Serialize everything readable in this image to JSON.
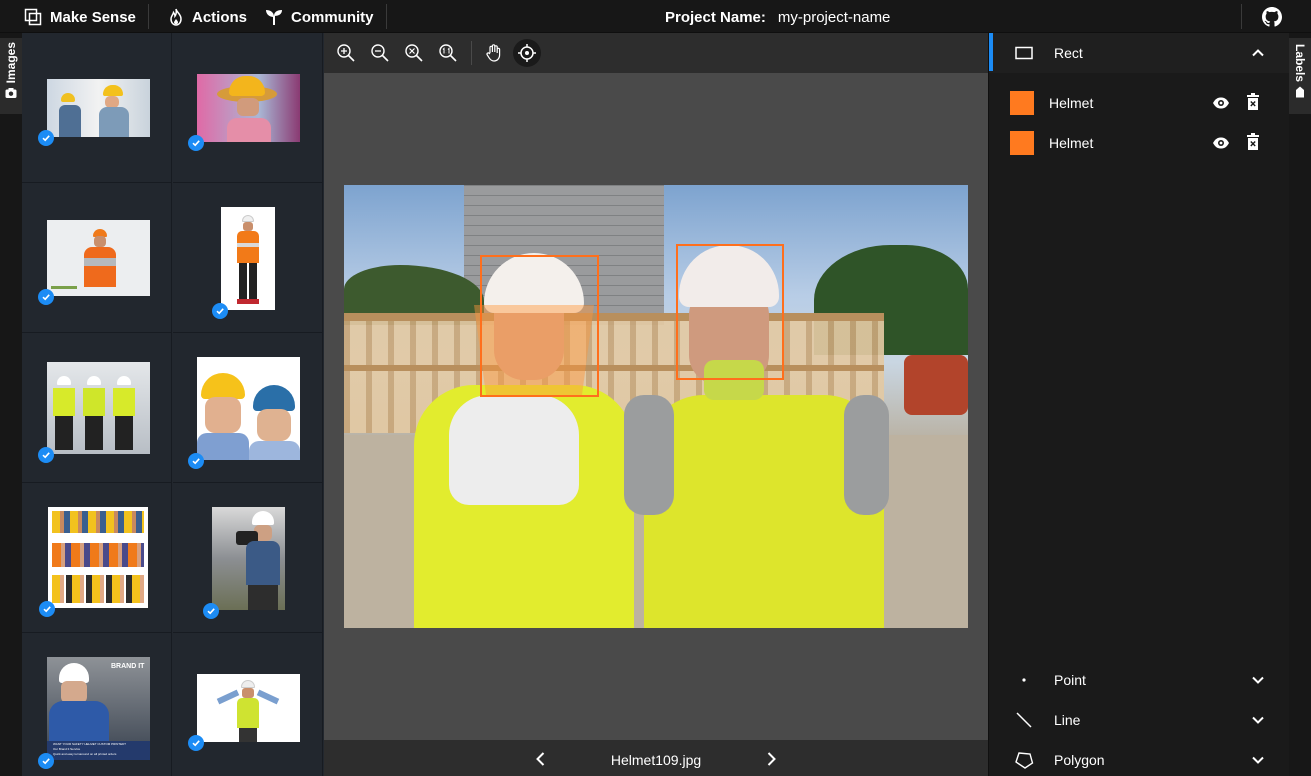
{
  "app": {
    "title": "Make Sense"
  },
  "menu": {
    "actions": "Actions",
    "community": "Community"
  },
  "project": {
    "label": "Project Name:",
    "name": "my-project-name"
  },
  "left_tab": {
    "label": "Images"
  },
  "right_tab": {
    "label": "Labels"
  },
  "gallery": {
    "images": [
      {
        "alt": "two workers in hard hats",
        "checked": true
      },
      {
        "alt": "worker with straw hat",
        "checked": true
      },
      {
        "alt": "worker arms crossed",
        "checked": true
      },
      {
        "alt": "standing worker orange vest",
        "checked": true
      },
      {
        "alt": "group of workers",
        "checked": true
      },
      {
        "alt": "two engineers helmets",
        "checked": true
      },
      {
        "alt": "crowd of workers",
        "checked": true
      },
      {
        "alt": "surveyor with camera",
        "checked": true
      },
      {
        "alt": "worker brand it poster",
        "checked": true,
        "poster_title": "BRAND IT",
        "poster_line1": "WANT YOUR SAFETY HELMET CUSTOM PRINTED?",
        "poster_line2": "Our Brand It Service",
        "poster_line3": "Quick and easy turnaround on all printed orders"
      },
      {
        "alt": "worker shrugging",
        "checked": true
      }
    ]
  },
  "editor": {
    "filename": "Helmet109.jpg",
    "annotations": [
      {
        "label": "Helmet",
        "color": "#ff6f1c"
      },
      {
        "label": "Helmet",
        "color": "#ff6f1c"
      }
    ]
  },
  "labels_panel": {
    "rect": {
      "label": "Rect",
      "expanded": true
    },
    "items": [
      {
        "name": "Helmet",
        "color": "#ff7a1f"
      },
      {
        "name": "Helmet",
        "color": "#ff7a1f"
      }
    ],
    "point": {
      "label": "Point"
    },
    "line": {
      "label": "Line"
    },
    "polygon": {
      "label": "Polygon"
    }
  },
  "colors": {
    "accent": "#1c8cf5",
    "label": "#ff7a1f"
  }
}
